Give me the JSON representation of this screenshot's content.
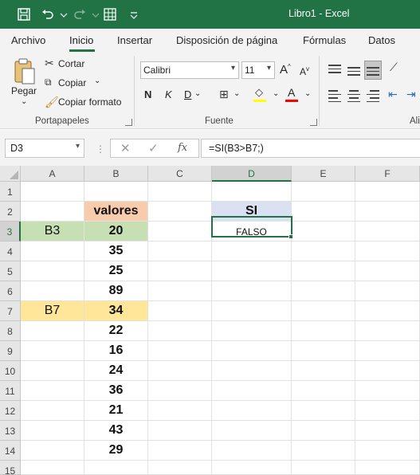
{
  "colors": {
    "accent": "#217346",
    "header_valores": "#f8cbad",
    "header_si": "#d9e1f2",
    "row3_fill": "#c6e0b4",
    "row7_fill": "#ffe699"
  },
  "titlebar": {
    "title": "Libro1  -  Excel",
    "icons": [
      "save-icon",
      "undo-icon",
      "redo-icon",
      "table-icon",
      "customize-icon"
    ]
  },
  "tabs": [
    "Archivo",
    "Inicio",
    "Insertar",
    "Disposición de página",
    "Fórmulas",
    "Datos"
  ],
  "active_tab": "Inicio",
  "ribbon": {
    "clipboard": {
      "paste": "Pegar",
      "cut": "Cortar",
      "copy": "Copiar",
      "format_painter": "Copiar formato",
      "label": "Portapapeles"
    },
    "font": {
      "font_name": "Calibri",
      "font_size": "11",
      "bold": "N",
      "italic": "K",
      "underline": "D",
      "label": "Fuente"
    },
    "alignment_label": "Ali"
  },
  "formula_bar": {
    "name_box": "D3",
    "cancel": "✕",
    "enter": "✓",
    "fx": "fx",
    "formula": "=SI(B3>B7;)"
  },
  "sheet": {
    "columns": [
      "A",
      "B",
      "C",
      "D",
      "E",
      "F"
    ],
    "selected_column": "D",
    "selected_row": "3",
    "selected_cell": "D3",
    "rows": [
      "1",
      "2",
      "3",
      "4",
      "5",
      "6",
      "7",
      "8",
      "9",
      "10",
      "11",
      "12",
      "13",
      "14",
      "15"
    ],
    "cells": {
      "B2": "valores",
      "D2": "SI",
      "A3": "B3",
      "B3": "20",
      "D3": "FALSO",
      "B4": "35",
      "B5": "25",
      "B6": "89",
      "A7": "B7",
      "B7": "34",
      "B8": "22",
      "B9": "16",
      "B10": "24",
      "B11": "36",
      "B12": "21",
      "B13": "43",
      "B14": "29"
    }
  }
}
